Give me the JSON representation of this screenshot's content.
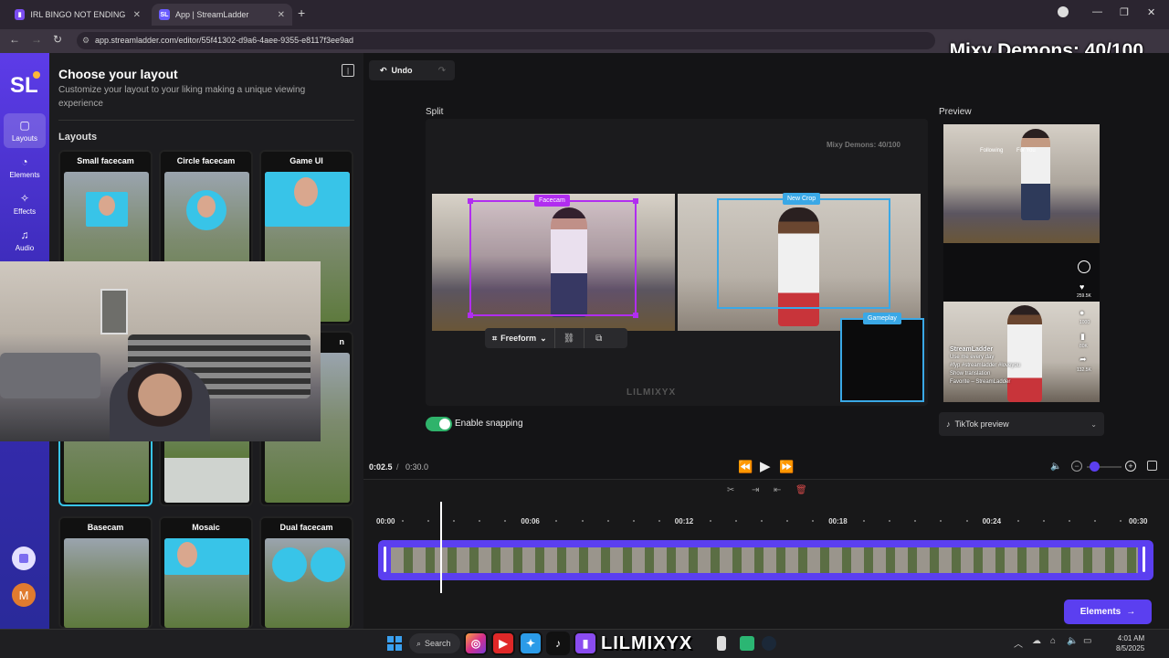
{
  "browser": {
    "tabs": [
      {
        "label": "IRL BINGO NOT ENDING TILL W",
        "active": false
      },
      {
        "label": "App | StreamLadder",
        "active": true
      }
    ],
    "url": "app.streamladder.com/editor/55f41302-d9a6-4aee-9355-e8117f3ee9ad"
  },
  "stream_overlay": {
    "score": "Mixy Demons: 40/100",
    "handle": "LILMIXYX"
  },
  "rail": {
    "logo": "SL",
    "items": [
      {
        "label": "Layouts",
        "icon": "layout-icon"
      },
      {
        "label": "Elements",
        "icon": "elements-icon"
      },
      {
        "label": "Effects",
        "icon": "effects-icon"
      },
      {
        "label": "Audio",
        "icon": "audio-icon"
      }
    ],
    "avatar_letter": "M"
  },
  "panel": {
    "title": "Choose your layout",
    "subtitle": "Customize your layout to your liking making a unique viewing experience",
    "section": "Layouts",
    "cards": [
      {
        "label": "Small facecam"
      },
      {
        "label": "Circle facecam"
      },
      {
        "label": "Game UI"
      },
      {
        "label": "Basecam"
      },
      {
        "label": "Mosaic"
      },
      {
        "label": "Dual facecam"
      }
    ],
    "partial_label": "n"
  },
  "editor": {
    "undo_label": "Undo",
    "split_label": "Split",
    "preview_label": "Preview",
    "canvas_score": "Mixy Demons: 40/100",
    "crops": {
      "facecam": "Facecam",
      "newcrop": "New Crop",
      "gameplay": "Gameplay"
    },
    "freeform_label": "Freeform",
    "watermark": "LILMIXYX",
    "snapping_label": "Enable snapping",
    "snapping_on": true,
    "preview_select": "TikTok preview",
    "phone": {
      "user": "StreamLadder",
      "line1": "Use me every day",
      "line2": "#fyp #streamladder #loveyou",
      "line3": "Show translation",
      "line4": "Favorite – StreamLadder",
      "likes": "259.5K",
      "comments": "1000",
      "saves": "80K",
      "shares": "132.5K",
      "tabs_following": "Following",
      "tabs_foryou": "For You"
    }
  },
  "playback": {
    "current": "0:02.5",
    "separator": "/",
    "total": "0:30.0"
  },
  "timeline": {
    "ticks": [
      "00:00",
      "00:06",
      "00:12",
      "00:18",
      "00:24",
      "00:30"
    ],
    "playhead_fraction": 0.083
  },
  "footer": {
    "elements_button": "Elements"
  },
  "taskbar": {
    "search": "Search",
    "time": "4:01 AM",
    "date": "8/5/2025"
  },
  "colors": {
    "accent": "#5b3ff0",
    "facecam": "#b12df0",
    "crop": "#3aa8e6",
    "toggle": "#2fb36b"
  }
}
